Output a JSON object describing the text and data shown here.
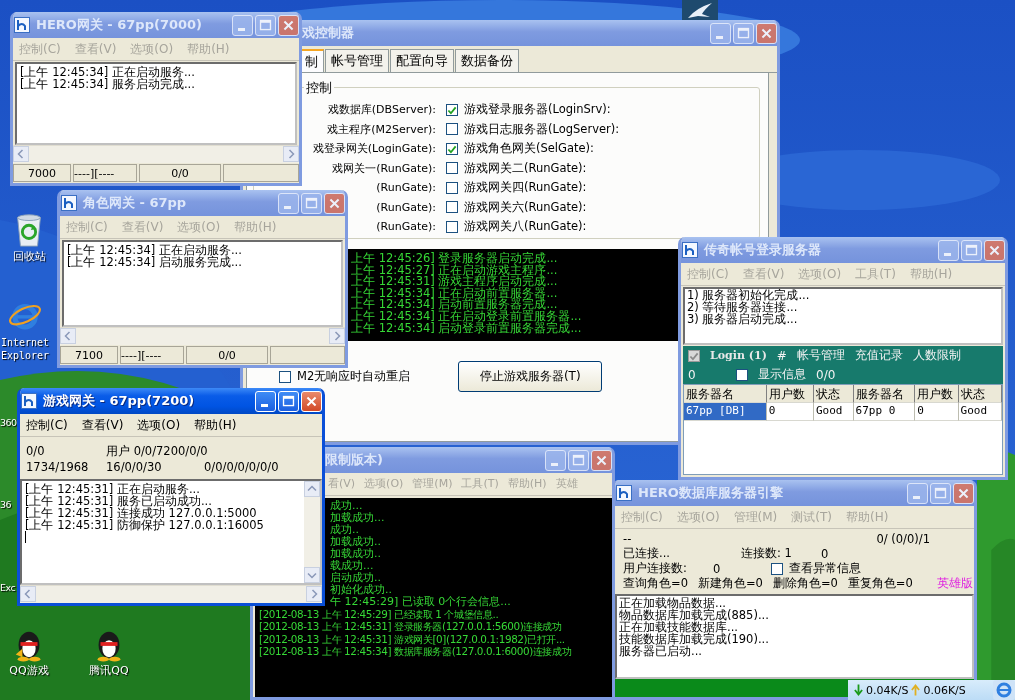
{
  "desktop_icons": [
    {
      "kind": "recycle",
      "label": "回收站"
    },
    {
      "kind": "ie",
      "label": "Internet Explorer"
    },
    {
      "kind": "qqgame",
      "label": "QQ游戏"
    },
    {
      "kind": "qq",
      "label": "腾讯QQ"
    }
  ],
  "desktop_cut_labels": [
    "360",
    "36",
    "Exc"
  ],
  "game_controller": {
    "title": "戏控制器",
    "active": false,
    "tabs": [
      {
        "label": "制",
        "selected": true
      },
      {
        "label": "帐号管理",
        "selected": false
      },
      {
        "label": "配置向导",
        "selected": false
      },
      {
        "label": "数据备份",
        "selected": false
      }
    ],
    "group_label": "控制",
    "left_labels": [
      "戏数据库(DBServer):",
      "戏主程序(M2Server):",
      "戏登录网关(LoginGate):",
      "戏网关一(RunGate):",
      "(RunGate):",
      "(RunGate):",
      "(RunGate):"
    ],
    "right_options": [
      {
        "label": "游戏登录服务器(LoginSrv):",
        "checked": true
      },
      {
        "label": "游戏日志服务器(LogServer):",
        "checked": false
      },
      {
        "label": "游戏角色网关(SelGate):",
        "checked": true
      },
      {
        "label": "游戏网关二(RunGate):",
        "checked": false
      },
      {
        "label": "游戏网关四(RunGate):",
        "checked": false
      },
      {
        "label": "游戏网关六(RunGate):",
        "checked": false
      },
      {
        "label": "游戏网关八(RunGate):",
        "checked": false
      }
    ],
    "log": [
      "上午 12:45:26] 登录服务器启动完成...",
      "上午 12:45:27] 正在启动游戏主程序...",
      "上午 12:45:31] 游戏主程序启动完成...",
      "上午 12:45:34] 正在启动前置服务器...",
      "上午 12:45:34] 启动前置服务器完成...",
      "上午 12:45:34] 正在启动登录前置服务器...",
      "上午 12:45:34] 启动登录前置服务器完成..."
    ],
    "auto_restart": {
      "label": "M2无响应时自动重启",
      "checked": false
    },
    "stop_button": "停止游戏服务器(T)"
  },
  "hero_gate": {
    "title": "HERO网关 - 67pp(7000)",
    "active": false,
    "menu": [
      "控制(C)",
      "查看(V)",
      "选项(O)",
      "帮助(H)"
    ],
    "log": [
      "[上午 12:45:34] 正在启动服务...",
      "[上午 12:45:34] 服务启动完成..."
    ],
    "status": [
      "7000",
      "----][----",
      "0/0"
    ]
  },
  "role_gate": {
    "title": "角色网关 - 67pp",
    "active": false,
    "menu": [
      "控制(C)",
      "查看(V)",
      "选项(O)",
      "帮助(H)"
    ],
    "log": [
      "[上午 12:45:34] 正在启动服务...",
      "[上午 12:45:34] 启动服务完成..."
    ],
    "status": [
      "7100",
      "----][----",
      "0/0"
    ]
  },
  "game_gate": {
    "title": "游戏网关 - 67pp(7200)",
    "active": true,
    "menu": [
      "控制(C)",
      "查看(V)",
      "选项(O)",
      "帮助(H)"
    ],
    "stats": [
      [
        "0/0",
        "用户 0/0/7200/0/0"
      ],
      [
        "1734/1968",
        "16/0/0/30",
        "0/0/0/0/0/0/0"
      ]
    ],
    "log": [
      "[上午 12:45:31] 正在启动服务...",
      "[上午 12:45:31] 服务已启动成功...",
      "[上午 12:45:31] 连接成功 127.0.0.1:5000",
      "[上午 12:45:31] 防御保护 127.0.0.1:16005"
    ]
  },
  "m2_server": {
    "title": "限制版本)",
    "active": false,
    "menu": [
      "看(V)",
      "选项(O)",
      "管理(M)",
      "工具(T)",
      "帮助(H)",
      "英雄"
    ],
    "log_partial": [
      "成功...",
      "加载成功...",
      "成功..",
      "加载成功..",
      "加载成功..",
      "载成功...",
      "启动成功..",
      "初始化成功..",
      "午 12:45:29] 已读取 0个行会信息..."
    ],
    "log": [
      "[2012-08-13 上午 12:45:29] 已经读取 1 个城堡信息..",
      "[2012-08-13 上午 12:45:31] 登录服务器(127.0.0.1:5600)连接成功",
      "[2012-08-13 上午 12:45:31] 游戏网关[0](127.0.0.1:1982)已打开...",
      "[2012-08-13 上午 12:45:34] 数据库服务器(127.0.0.1:6000)连接成功"
    ]
  },
  "db_engine": {
    "title": "HERO数据库服务器引擎",
    "active": false,
    "menu": [
      "控制(C)",
      "选项(O)",
      "管理(M)",
      "测试(T)",
      "帮助(H)"
    ],
    "dash": "--",
    "counter": "0/ (0/0)/1",
    "connected": "已连接...",
    "conn_label": "连接数: 1",
    "conn_extra": "0",
    "user_conn_label": "用户连接数:",
    "user_conn_value": "0",
    "show_errors": {
      "label": "查看异常信息",
      "checked": false
    },
    "role_stats": [
      "查询角色=0",
      "新建角色=0",
      "删除角色=0",
      "重复角色=0"
    ],
    "edition": "英雄版",
    "log": [
      "正在加载物品数据...",
      "物品数据库加载完成(885)...",
      "正在加载技能数据库...",
      "技能数据库加载完成(190)...",
      "服务器已启动..."
    ]
  },
  "account_login": {
    "title": "传奇帐号登录服务器",
    "active": false,
    "menu": [
      "控制(C)",
      "查看(V)",
      "选项(O)",
      "工具(T)",
      "帮助(H)"
    ],
    "log": [
      "1) 服务器初始化完成...",
      "2) 等待服务器连接...",
      "3) 服务器启动完成..."
    ],
    "login_check": {
      "label": "Login (1)",
      "checked": true
    },
    "hash": "#",
    "links": [
      "帐号管理",
      "充值记录",
      "人数限制"
    ],
    "count": "0",
    "show_info": {
      "label": "显示信息",
      "checked": false
    },
    "ratio": "0/0",
    "columns": [
      "服务器名",
      "用户数",
      "状态",
      "服务器名",
      "用户数",
      "状态"
    ],
    "rows": [
      {
        "selected": true,
        "cells": [
          "67pp [DB]",
          "0",
          "Good",
          "67pp 0",
          "0",
          "Good"
        ]
      }
    ]
  },
  "tray": {
    "down": "0.04K/S",
    "up": "0.06K/S"
  }
}
